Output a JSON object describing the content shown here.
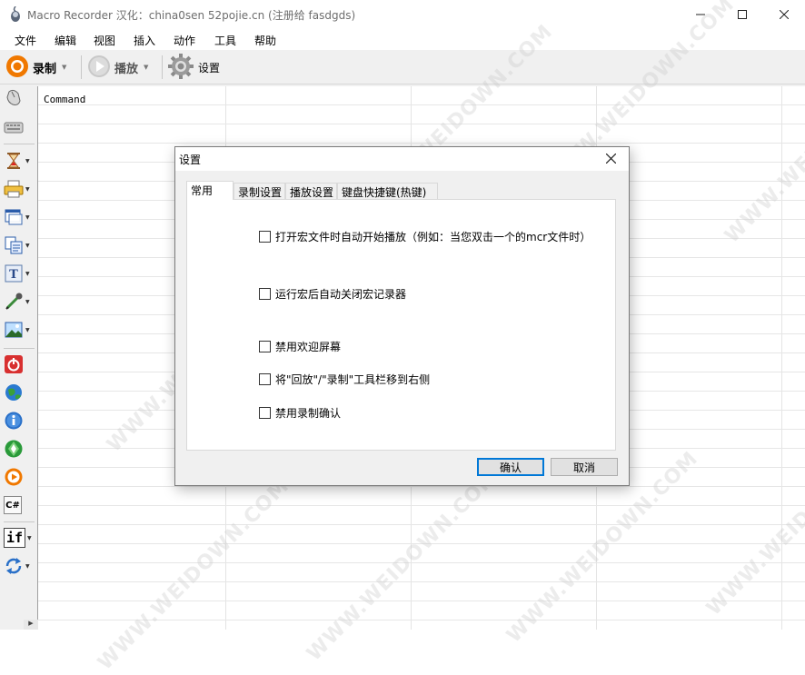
{
  "window": {
    "title": "Macro Recorder 汉化：china0sen 52pojie.cn (注册给 fasdgds)"
  },
  "menu": [
    "文件",
    "编辑",
    "视图",
    "插入",
    "动作",
    "工具",
    "帮助"
  ],
  "toolbar": {
    "record_label": "录制",
    "play_label": "播放",
    "settings_label": "设置"
  },
  "left_toolbar": [
    "mouse-icon",
    "keyboard-icon",
    "hourglass-icon",
    "printer-icon",
    "window-icon",
    "copy-icon",
    "text-icon",
    "pipette-icon",
    "image-icon",
    "power-icon",
    "globe-icon",
    "info-icon",
    "run-icon",
    "play-icon",
    "csharp-icon",
    "if-label",
    "loop-icon"
  ],
  "grid": {
    "header": "Command"
  },
  "dialog": {
    "title": "设置",
    "tabs": [
      "常用",
      "录制设置",
      "播放设置",
      "键盘快捷键(热键)"
    ],
    "active_tab": "常用",
    "options": [
      "打开宏文件时自动开始播放（例如：当您双击一个的mcr文件时）",
      "运行宏后自动关闭宏记录器",
      "禁用欢迎屏幕",
      "将\"回放\"/\"录制\"工具栏移到右侧",
      "禁用录制确认"
    ],
    "ok_label": "确认",
    "cancel_label": "取消"
  },
  "if_text": "if",
  "csharp_text": "C#",
  "watermark": "WWW.WEIDOWN.COM",
  "colors": {
    "record": "#f07800",
    "accent": "#0078d7"
  }
}
